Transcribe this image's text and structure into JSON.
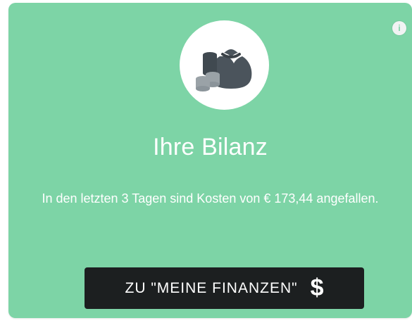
{
  "widget": {
    "info_icon": "info-icon",
    "title": "Ihre Bilanz",
    "message": "In den letzten 3 Tagen sind Kosten von € 173,44 angefallen.",
    "cta_label": "ZU \"MEINE FINANZEN\"",
    "cta_icon": "$",
    "illustration_icon": "money-bag-coins-icon",
    "colors": {
      "card_bg": "#7dd4a6",
      "button_bg": "#1c1f20",
      "icon_dark": "#4b545c"
    }
  }
}
